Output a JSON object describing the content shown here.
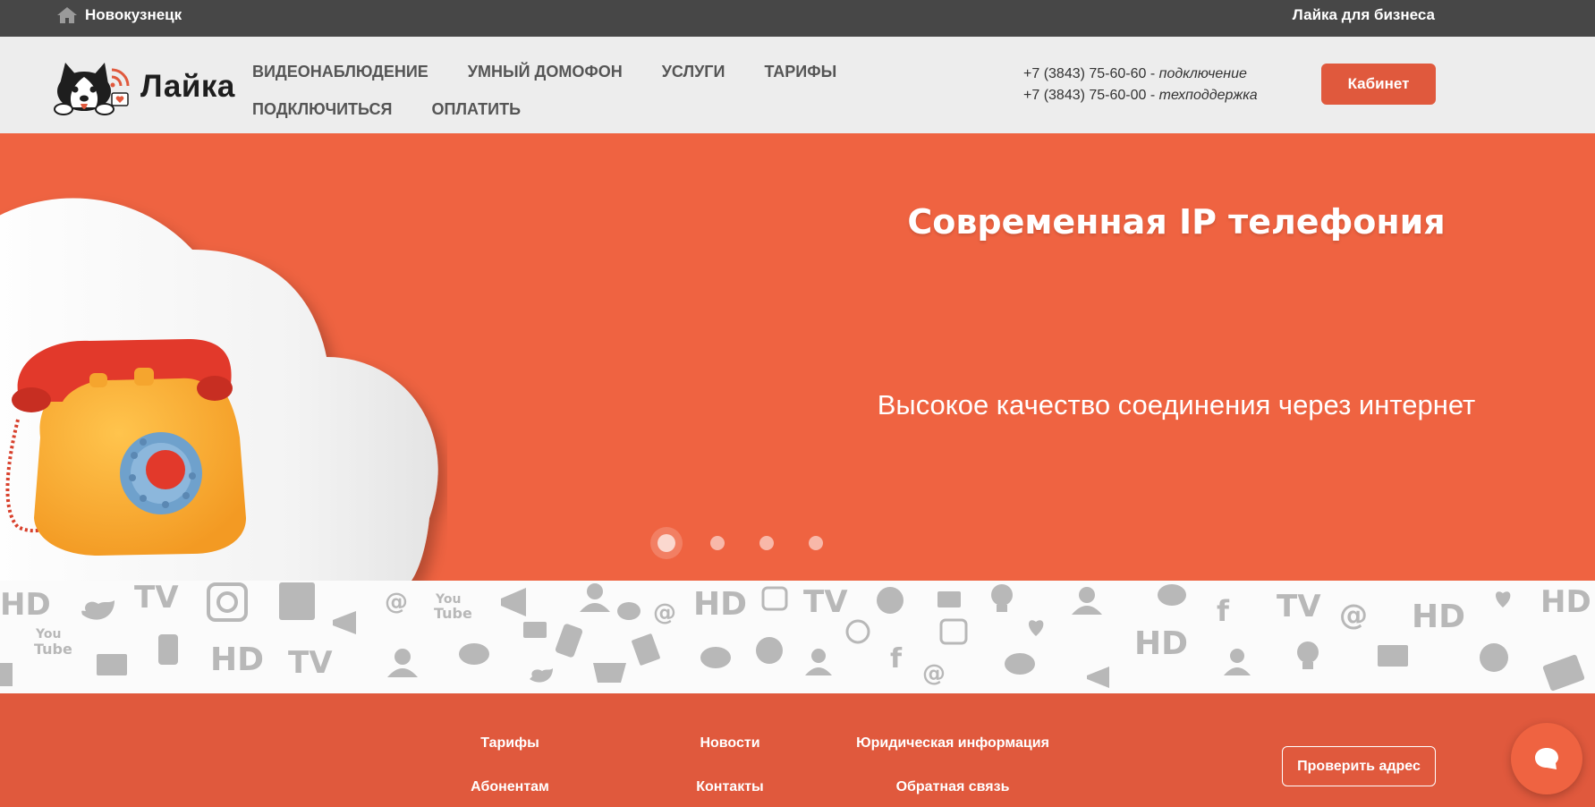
{
  "topbar": {
    "city": "Новокузнецк",
    "business_link": "Лайка для бизнеса"
  },
  "header": {
    "logo_text": "Лайка",
    "nav_row1": [
      "ВИДЕОНАБЛЮДЕНИЕ",
      "УМНЫЙ ДОМОФОН",
      "УСЛУГИ",
      "ТАРИФЫ"
    ],
    "nav_row2": [
      "ПОДКЛЮЧИТЬСЯ",
      "ОПЛАТИТЬ"
    ],
    "phone1": "+7 (3843) 75-60-60 - ",
    "phone1_note": "подключение",
    "phone2": "+7 (3843) 75-60-00 - ",
    "phone2_note": "техподдержка",
    "cabinet_button": "Кабинет"
  },
  "hero": {
    "title": "Современная IP телефония",
    "subtitle": "Высокое качество соединения через интернет",
    "slides_count": 4,
    "active_slide": 1,
    "background_color": "#ef6341"
  },
  "footer": {
    "links": [
      "Тарифы",
      "Новости",
      "Юридическая информация",
      "Абонентам",
      "Контакты",
      "Обратная связь"
    ],
    "check_address_button": "Проверить адрес",
    "background_color": "#e0593d"
  }
}
